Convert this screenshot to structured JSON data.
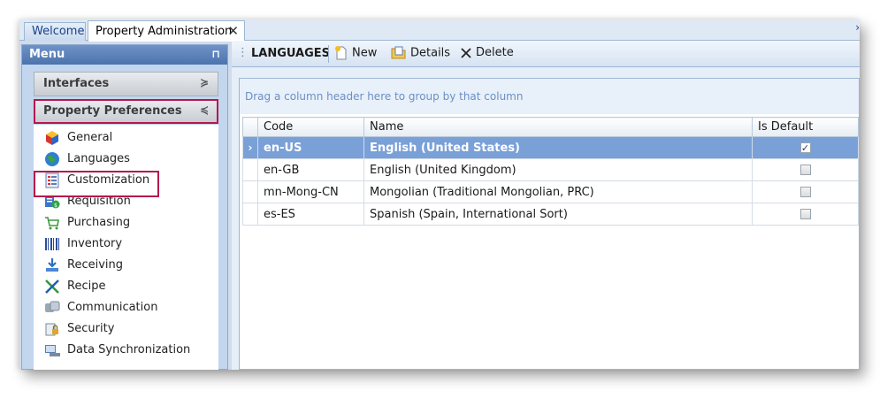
{
  "tabs": {
    "welcome": "Welcome",
    "active": "Property Administration",
    "close_glyph": "✕",
    "scroll_glyph": "›"
  },
  "sidebar": {
    "title": "Menu",
    "pin_glyph": "⊓",
    "groups": [
      {
        "label": "Interfaces",
        "chevron": "≽"
      },
      {
        "label": "Property Preferences",
        "chevron": "≼"
      }
    ],
    "items": [
      {
        "label": "General",
        "icon": "cube-icon"
      },
      {
        "label": "Languages",
        "icon": "globe-icon"
      },
      {
        "label": "Customization",
        "icon": "form-icon"
      },
      {
        "label": "Requisition",
        "icon": "requisition-icon"
      },
      {
        "label": "Purchasing",
        "icon": "cart-icon"
      },
      {
        "label": "Inventory",
        "icon": "barcode-icon"
      },
      {
        "label": "Receiving",
        "icon": "download-icon"
      },
      {
        "label": "Recipe",
        "icon": "utensils-icon"
      },
      {
        "label": "Communication",
        "icon": "network-icon"
      },
      {
        "label": "Security",
        "icon": "lock-icon"
      },
      {
        "label": "Data Synchronization",
        "icon": "sync-icon"
      }
    ]
  },
  "toolbar": {
    "title": "LANGUAGES",
    "new_label": "New",
    "details_label": "Details",
    "delete_label": "Delete"
  },
  "grid": {
    "group_hint": "Drag a column header here to group by that column",
    "columns": [
      "Code",
      "Name",
      "Is Default"
    ],
    "rows": [
      {
        "code": "en-US",
        "name": "English (United States)",
        "is_default": true,
        "selected": true
      },
      {
        "code": "en-GB",
        "name": "English (United Kingdom)",
        "is_default": false,
        "selected": false
      },
      {
        "code": "mn-Mong-CN",
        "name": "Mongolian (Traditional Mongolian, PRC)",
        "is_default": false,
        "selected": false
      },
      {
        "code": "es-ES",
        "name": "Spanish (Spain, International Sort)",
        "is_default": false,
        "selected": false
      }
    ],
    "row_indicator": "›",
    "check_glyph": "✓"
  },
  "colors": {
    "accent": "#4c73ad",
    "selection": "#7aa0d8",
    "highlight_border": "#b5174c"
  }
}
